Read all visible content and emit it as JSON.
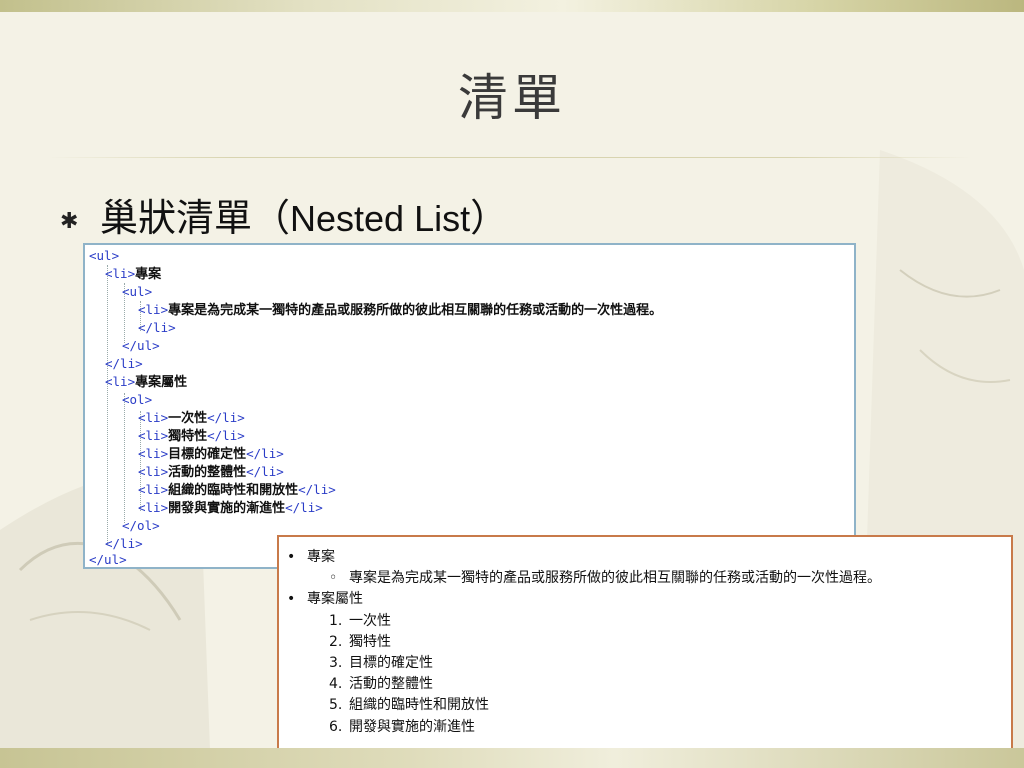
{
  "slide": {
    "title": "清單",
    "bullet_cjk": "巢狀清單（",
    "bullet_latin": "Nested List",
    "bullet_close": "）"
  },
  "code": {
    "ul_open": "<ul>",
    "li_open": "<li>",
    "li_close": "</li>",
    "ul_close": "</ul>",
    "ol_open": "<ol>",
    "ol_close": "</ol>",
    "item1": "專案",
    "item1_sub": "專案是為完成某一獨特的產品或服務所做的彼此相互關聯的任務或活動的一次性過程。",
    "item2": "專案屬性",
    "props": [
      "一次性",
      "獨特性",
      "目標的確定性",
      "活動的整體性",
      "組織的臨時性和開放性",
      "開發與實施的漸進性"
    ]
  },
  "rendered": {
    "bullet_mark": "•",
    "sub_mark": "◦",
    "item1": "專案",
    "item1_sub": "專案是為完成某一獨特的產品或服務所做的彼此相互關聯的任務或活動的一次性過程。",
    "item2": "專案屬性",
    "numbers": [
      "1.",
      "2.",
      "3.",
      "4.",
      "5.",
      "6."
    ],
    "props": [
      "一次性",
      "獨特性",
      "目標的確定性",
      "活動的整體性",
      "組織的臨時性和開放性",
      "開發與實施的漸進性"
    ]
  },
  "colors": {
    "tag": "#2a3cc7",
    "code_border": "#8fb3c8",
    "render_border": "#c87a4a",
    "background": "#f4f2e6"
  }
}
